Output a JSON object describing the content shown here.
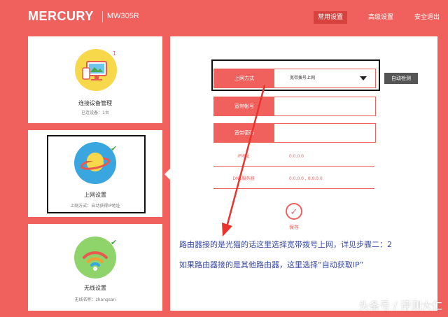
{
  "header": {
    "brand": "MERCURY",
    "model": "MW305R",
    "nav": [
      {
        "label": "常用设置",
        "active": true
      },
      {
        "label": "高级设置",
        "active": false
      },
      {
        "label": "安全退出",
        "active": false
      }
    ]
  },
  "cards": [
    {
      "title": "连接设备管理",
      "sub": "已连设备：1台",
      "badge": "1"
    },
    {
      "title": "上网设置",
      "sub": "上网方式：自动获得IP地址"
    },
    {
      "title": "无线设置",
      "sub": "无线名称：zhangsan"
    }
  ],
  "form": {
    "wan_label": "上网方式",
    "wan_value": "宽带拨号上网",
    "auto_detect": "自动检测",
    "account_label": "宽带帐号",
    "password_label": "宽带密码",
    "ip_label": "IP地址",
    "ip_value": "0.0.0.0",
    "dns_label": "DNS服务器",
    "dns_value": "0.0.0.0 , 0.0.0.0",
    "save_label": "保存"
  },
  "notes": {
    "line1": "路由器接的是光猫的话这里选择宽带拨号上网，详见步骤二：2",
    "line2": "如果路由器接的是其他路由器，这里选择“自动获取IP”"
  },
  "watermark": "头条号 / 评测大仁",
  "colors": {
    "accent": "#f0605c",
    "annotation": "#3a4aa8"
  }
}
